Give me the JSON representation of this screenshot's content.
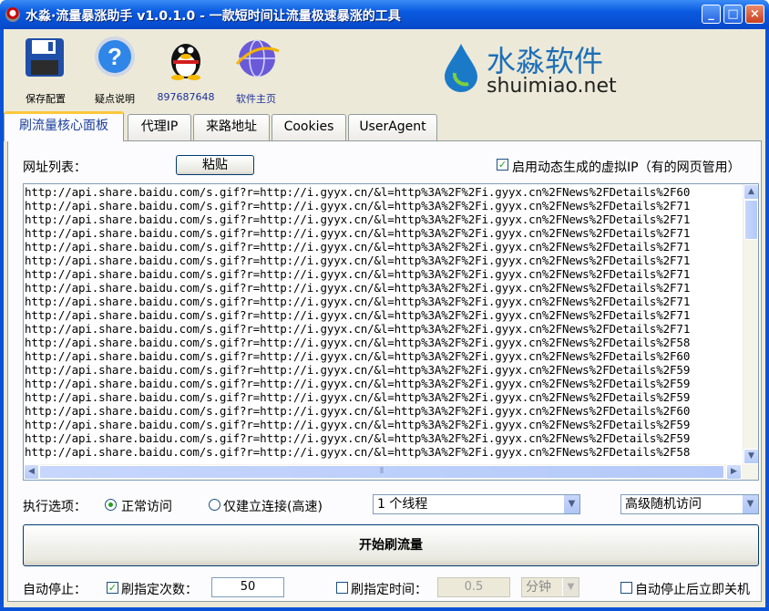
{
  "window": {
    "title": "水淼·流量暴涨助手 v1.0.1.0 - 一款短时间让流量极速暴涨的工具",
    "min": "_",
    "max": "□",
    "close": "×"
  },
  "toolbar": {
    "save": "保存配置",
    "help": "疑点说明",
    "qq": "897687648",
    "home": "软件主页"
  },
  "logo": {
    "name": "水淼软件",
    "domain": "shuimiao.net"
  },
  "tabs": [
    "刷流量核心面板",
    "代理IP",
    "来路地址",
    "Cookies",
    "UserAgent"
  ],
  "panel": {
    "url_list_label": "网址列表：",
    "paste_button": "粘贴",
    "virtual_ip_checkbox": "启用动态生成的虚拟IP（有的网页管用）",
    "urls": [
      "http://api.share.baidu.com/s.gif?r=http://i.gyyx.cn/&l=http%3A%2F%2Fi.gyyx.cn%2FNews%2FDetails%2F60",
      "http://api.share.baidu.com/s.gif?r=http://i.gyyx.cn/&l=http%3A%2F%2Fi.gyyx.cn%2FNews%2FDetails%2F71",
      "http://api.share.baidu.com/s.gif?r=http://i.gyyx.cn/&l=http%3A%2F%2Fi.gyyx.cn%2FNews%2FDetails%2F71",
      "http://api.share.baidu.com/s.gif?r=http://i.gyyx.cn/&l=http%3A%2F%2Fi.gyyx.cn%2FNews%2FDetails%2F71",
      "http://api.share.baidu.com/s.gif?r=http://i.gyyx.cn/&l=http%3A%2F%2Fi.gyyx.cn%2FNews%2FDetails%2F71",
      "http://api.share.baidu.com/s.gif?r=http://i.gyyx.cn/&l=http%3A%2F%2Fi.gyyx.cn%2FNews%2FDetails%2F71",
      "http://api.share.baidu.com/s.gif?r=http://i.gyyx.cn/&l=http%3A%2F%2Fi.gyyx.cn%2FNews%2FDetails%2F71",
      "http://api.share.baidu.com/s.gif?r=http://i.gyyx.cn/&l=http%3A%2F%2Fi.gyyx.cn%2FNews%2FDetails%2F71",
      "http://api.share.baidu.com/s.gif?r=http://i.gyyx.cn/&l=http%3A%2F%2Fi.gyyx.cn%2FNews%2FDetails%2F71",
      "http://api.share.baidu.com/s.gif?r=http://i.gyyx.cn/&l=http%3A%2F%2Fi.gyyx.cn%2FNews%2FDetails%2F71",
      "http://api.share.baidu.com/s.gif?r=http://i.gyyx.cn/&l=http%3A%2F%2Fi.gyyx.cn%2FNews%2FDetails%2F71",
      "http://api.share.baidu.com/s.gif?r=http://i.gyyx.cn/&l=http%3A%2F%2Fi.gyyx.cn%2FNews%2FDetails%2F58",
      "http://api.share.baidu.com/s.gif?r=http://i.gyyx.cn/&l=http%3A%2F%2Fi.gyyx.cn%2FNews%2FDetails%2F60",
      "http://api.share.baidu.com/s.gif?r=http://i.gyyx.cn/&l=http%3A%2F%2Fi.gyyx.cn%2FNews%2FDetails%2F59",
      "http://api.share.baidu.com/s.gif?r=http://i.gyyx.cn/&l=http%3A%2F%2Fi.gyyx.cn%2FNews%2FDetails%2F59",
      "http://api.share.baidu.com/s.gif?r=http://i.gyyx.cn/&l=http%3A%2F%2Fi.gyyx.cn%2FNews%2FDetails%2F59",
      "http://api.share.baidu.com/s.gif?r=http://i.gyyx.cn/&l=http%3A%2F%2Fi.gyyx.cn%2FNews%2FDetails%2F60",
      "http://api.share.baidu.com/s.gif?r=http://i.gyyx.cn/&l=http%3A%2F%2Fi.gyyx.cn%2FNews%2FDetails%2F59",
      "http://api.share.baidu.com/s.gif?r=http://i.gyyx.cn/&l=http%3A%2F%2Fi.gyyx.cn%2FNews%2FDetails%2F59",
      "http://api.share.baidu.com/s.gif?r=http://i.gyyx.cn/&l=http%3A%2F%2Fi.gyyx.cn%2FNews%2FDetails%2F58"
    ],
    "exec_label": "执行选项：",
    "radio_normal": "正常访问",
    "radio_connect": "仅建立连接(高速)",
    "threads_value": "1 个线程",
    "mode_value": "高级随机访问",
    "start_button": "开始刷流量",
    "auto_stop_label": "自动停止：",
    "count_checkbox": "刷指定次数：",
    "count_value": "50",
    "time_checkbox": "刷指定时间：",
    "time_value": "0.5",
    "time_unit": "分钟",
    "shutdown_checkbox": "自动停止后立即关机",
    "hscroll_grip": "⦀"
  }
}
